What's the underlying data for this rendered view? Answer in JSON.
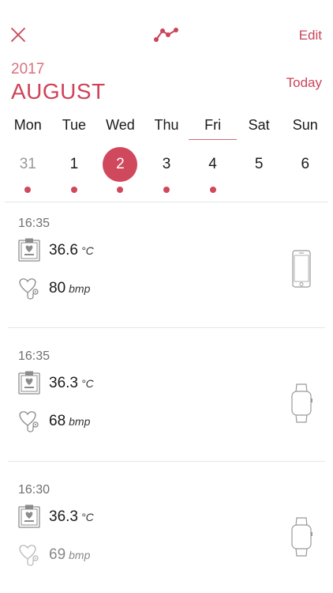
{
  "header": {
    "close_icon": "close-icon",
    "chart_icon": "trend-chart-icon",
    "edit_label": "Edit",
    "year": "2017",
    "month": "AUGUST",
    "today_label": "Today"
  },
  "calendar": {
    "weekdays": [
      "Mon",
      "Tue",
      "Wed",
      "Thu",
      "Fri",
      "Sat",
      "Sun"
    ],
    "today_weekday": "Fri",
    "days": [
      {
        "num": "31",
        "muted": true,
        "has_entries": true,
        "selected": false
      },
      {
        "num": "1",
        "muted": false,
        "has_entries": true,
        "selected": false
      },
      {
        "num": "2",
        "muted": false,
        "has_entries": true,
        "selected": true
      },
      {
        "num": "3",
        "muted": false,
        "has_entries": true,
        "selected": false
      },
      {
        "num": "4",
        "muted": false,
        "has_entries": true,
        "selected": false
      },
      {
        "num": "5",
        "muted": false,
        "has_entries": false,
        "selected": false
      },
      {
        "num": "6",
        "muted": false,
        "has_entries": false,
        "selected": false
      }
    ]
  },
  "entries": [
    {
      "time": "16:35",
      "temperature": "36.6",
      "temp_unit": "°C",
      "heart_rate": "80",
      "hr_unit": "bmp",
      "device": "phone-icon"
    },
    {
      "time": "16:35",
      "temperature": "36.3",
      "temp_unit": "°C",
      "heart_rate": "68",
      "hr_unit": "bmp",
      "device": "watch-icon"
    },
    {
      "time": "16:30",
      "temperature": "36.3",
      "temp_unit": "°C",
      "heart_rate": "69",
      "hr_unit": "bmp",
      "device": "watch-icon"
    }
  ],
  "colors": {
    "accent": "#d0485b",
    "accent_light": "#d9707f",
    "separator": "#e6e6e6",
    "icon_gray": "#8c8c8c"
  }
}
